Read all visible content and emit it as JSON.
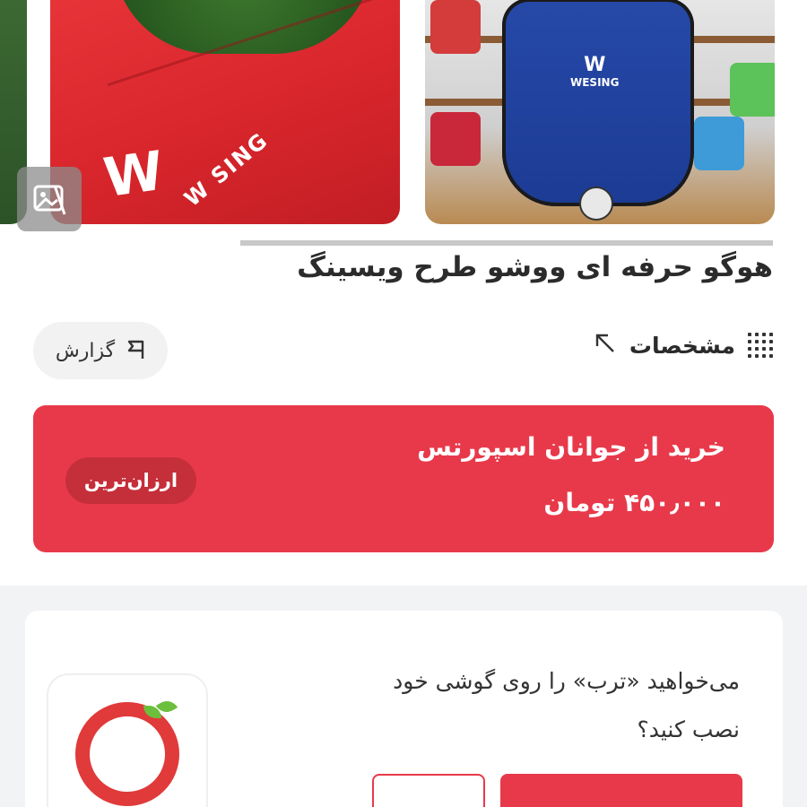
{
  "product": {
    "title": "هوگو حرفه ای ووشو طرح ویسینگ"
  },
  "gallery": {
    "image1_brand_text": "W SING",
    "image2_brand_text": "WESING"
  },
  "actions": {
    "report_label": "گزارش",
    "specs_label": "مشخصات"
  },
  "offer": {
    "seller_text": "خرید از جوانان اسپورتس",
    "price_text": "۴۵۰٫۰۰۰ تومان",
    "badge_label": "ارزان‌ترین"
  },
  "install_prompt": {
    "line1": "می‌خواهید «ترب» را روی گوشی خود",
    "line2": "نصب کنید؟"
  },
  "colors": {
    "accent": "#e8394a",
    "logo_red": "#e03a3a",
    "logo_green": "#6cbf3c"
  }
}
